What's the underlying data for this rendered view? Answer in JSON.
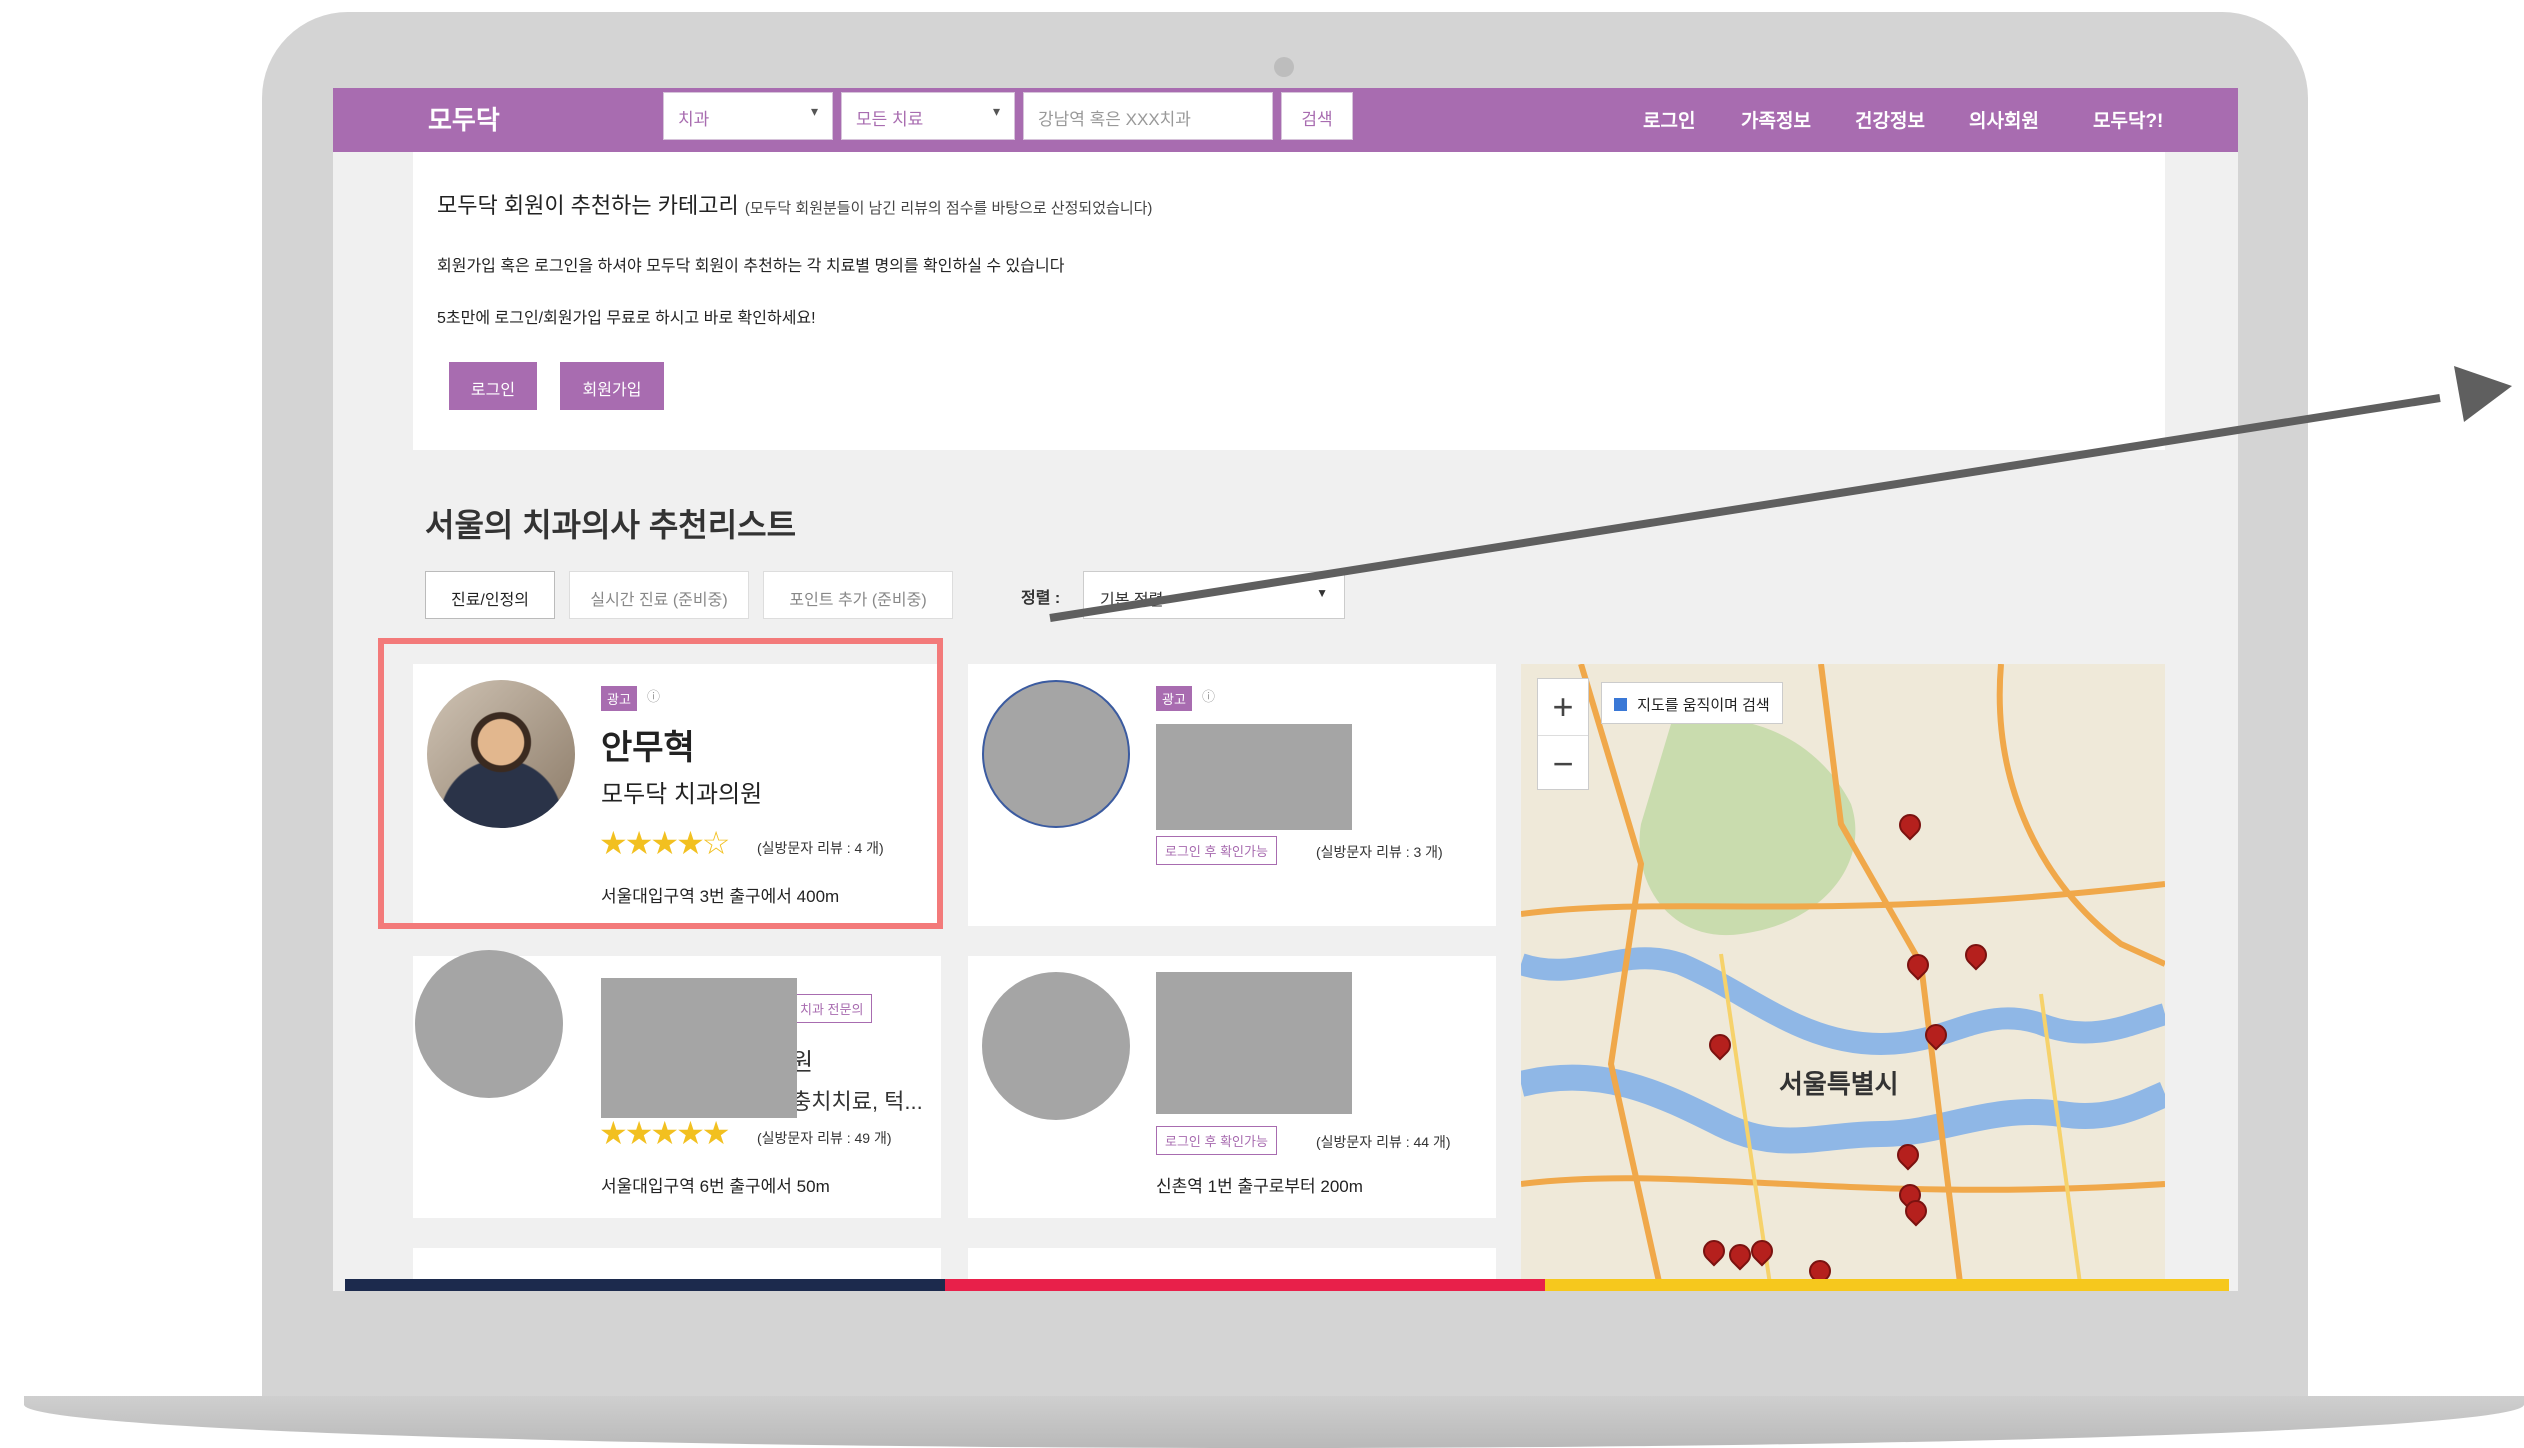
{
  "nav": {
    "logo": "모두닥",
    "category_select": "치과",
    "treatment_select": "모든 치료",
    "search_placeholder": "강남역 혹은 XXX치과",
    "search_button": "검색",
    "links": [
      "로그인",
      "가족정보",
      "건강정보",
      "의사회원",
      "모두닥?!"
    ]
  },
  "info": {
    "title": "모두닥 회원이 추천하는 카테고리",
    "title_note": "(모두닥 회원분들이 남긴 리뷰의 점수를 바탕으로 산정되었습니다)",
    "line1": "회원가입 혹은 로그인을 하셔야 모두닥 회원이 추천하는 각 치료별 명의를 확인하실 수 있습니다",
    "line2": "5초만에 로그인/회원가입 무료로 하시고 바로 확인하세요!",
    "login_button": "로그인",
    "signup_button": "회원가입"
  },
  "list": {
    "title": "서울의 치과의사 추천리스트",
    "filters": [
      "진료/인정의",
      "실시간 진료 (준비중)",
      "포인트 추가 (준비중)"
    ],
    "sort_label": "정렬 :",
    "sort_value": "기본 정렬"
  },
  "cards": [
    {
      "ad": "광고",
      "name": "안무혁",
      "clinic": "모두닥 치과의원",
      "rating": 3.5,
      "stars": "★★★★☆",
      "review": "(실방문자 리뷰 : 4 개)",
      "location": "서울대입구역 3번 출구에서 400m"
    },
    {
      "ad": "광고",
      "login_tag": "로그인 후 확인가능",
      "review": "(실방문자 리뷰 : 3 개)"
    },
    {
      "specialty": "치과 전문의",
      "partial_name": "원",
      "partial_clinic": "충치치료, 턱...",
      "stars": "★★★★★",
      "rating": 4.5,
      "review": "(실방문자 리뷰 : 49 개)",
      "location": "서울대입구역 6번 출구에서 50m"
    },
    {
      "login_tag": "로그인 후 확인가능",
      "review": "(실방문자 리뷰 : 44 개)",
      "location": "신촌역 1번 출구로부터 200m"
    }
  ],
  "map": {
    "checkbox_label": "지도를 움직이며 검색",
    "zoom_in": "+",
    "zoom_out": "−",
    "city_label": "서울특별시"
  },
  "colors": {
    "brand": "#a86cb0",
    "highlight": "#f37a7a",
    "star": "#f2c020"
  }
}
